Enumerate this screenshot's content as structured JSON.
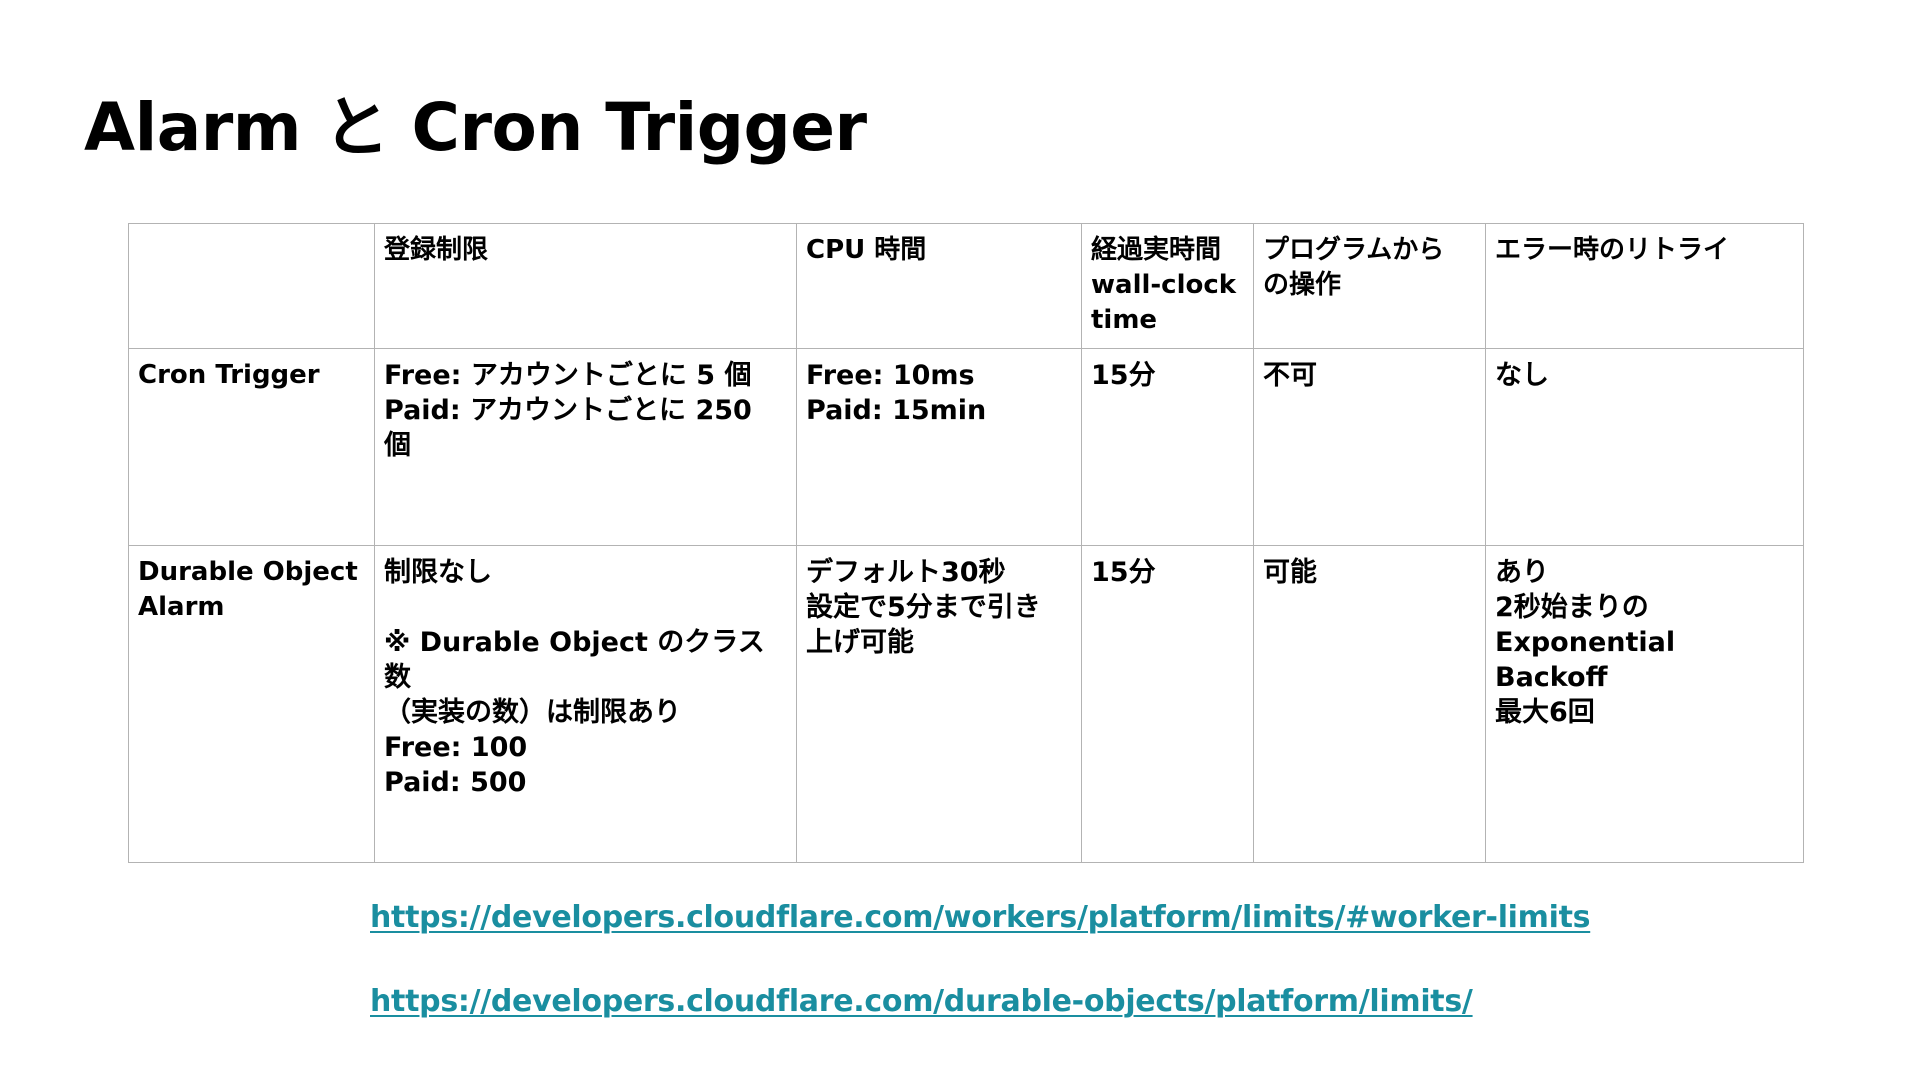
{
  "slide": {
    "title": "Alarm と Cron Trigger"
  },
  "table": {
    "headers": [
      "",
      "登録制限",
      "CPU 時間",
      "経過実時間\nwall-clock\ntime",
      "プログラムから\nの操作",
      "エラー時のリトライ"
    ],
    "rows": [
      {
        "name": "Cron Trigger",
        "cells": [
          "Free: アカウントごとに 5 個\nPaid: アカウントごとに 250\n個",
          "Free: 10ms\nPaid: 15min",
          "15分",
          "不可",
          "なし"
        ]
      },
      {
        "name": "Durable Object\nAlarm",
        "cells": [
          "制限なし\n\n※ Durable Object のクラス数\n（実装の数）は制限あり\nFree: 100\nPaid: 500",
          "デフォルト30秒\n設定で5分まで引き\n上げ可能",
          "15分",
          "可能",
          "あり\n2秒始まりの\nExponential Backoff\n最大6回"
        ]
      }
    ]
  },
  "links": [
    "https://developers.cloudflare.com/workers/platform/limits/#worker-limits",
    "https://developers.cloudflare.com/durable-objects/platform/limits/"
  ],
  "colors": {
    "link": "#1a8ea0",
    "table_border": "#b3b3b3",
    "text": "#000000",
    "background": "#ffffff"
  }
}
